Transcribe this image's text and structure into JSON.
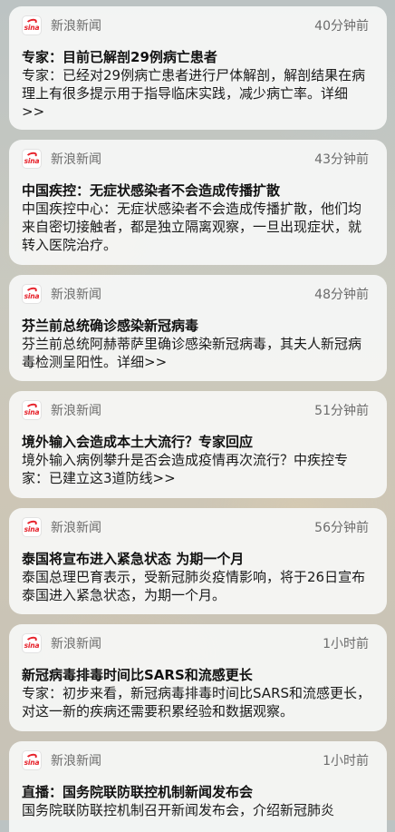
{
  "notifications": [
    {
      "app": "新浪新闻",
      "app_icon": "sina-logo-icon",
      "time": "40分钟前",
      "title": "专家：目前已解剖29例病亡患者",
      "body": "专家：已经对29例病亡患者进行尸体解剖，解剖结果在病理上有很多提示用于指导临床实践，减少病亡率。详细>>"
    },
    {
      "app": "新浪新闻",
      "app_icon": "sina-logo-icon",
      "time": "43分钟前",
      "title": "中国疾控：无症状感染者不会造成传播扩散",
      "body": "中国疾控中心：无症状感染者不会造成传播扩散，他们均来自密切接触者，都是独立隔离观察，一旦出现症状，就转入医院治疗。"
    },
    {
      "app": "新浪新闻",
      "app_icon": "sina-logo-icon",
      "time": "48分钟前",
      "title": "芬兰前总统确诊感染新冠病毒",
      "body": "芬兰前总统阿赫蒂萨里确诊感染新冠病毒，其夫人新冠病毒检测呈阳性。详细>>"
    },
    {
      "app": "新浪新闻",
      "app_icon": "sina-logo-icon",
      "time": "51分钟前",
      "title": "境外输入会造成本土大流行？专家回应",
      "body": "境外输入病例攀升是否会造成疫情再次流行？中疾控专家：已建立这3道防线>>"
    },
    {
      "app": "新浪新闻",
      "app_icon": "sina-logo-icon",
      "time": "56分钟前",
      "title": "泰国将宣布进入紧急状态 为期一个月",
      "body": "泰国总理巴育表示，受新冠肺炎疫情影响，将于26日宣布泰国进入紧急状态，为期一个月。"
    },
    {
      "app": "新浪新闻",
      "app_icon": "sina-logo-icon",
      "time": "1小时前",
      "title": "新冠病毒排毒时间比SARS和流感更长",
      "body": "专家：初步来看，新冠病毒排毒时间比SARS和流感更长，对这一新的疾病还需要积累经验和数据观察。"
    },
    {
      "app": "新浪新闻",
      "app_icon": "sina-logo-icon",
      "time": "1小时前",
      "title": "直播：国务院联防联控机制新闻发布会",
      "body": "国务院联防联控机制召开新闻发布会，介绍新冠肺炎"
    }
  ],
  "logo_text": "sina"
}
